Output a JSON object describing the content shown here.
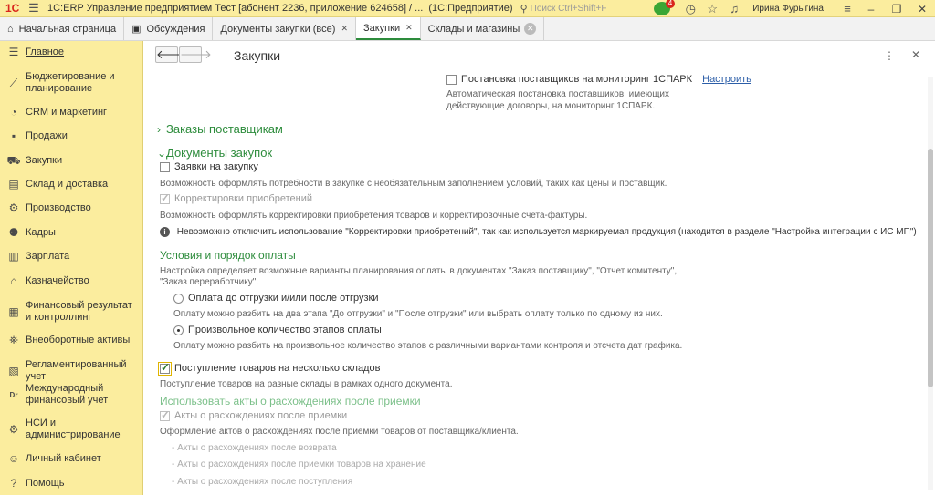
{
  "topbar": {
    "logo": "1С",
    "app_title": "1С:ERP Управление предприятием Тест [абонент 2236, приложение 624658] / ...",
    "platform": "(1С:Предприятие)",
    "search_placeholder": "Поиск Ctrl+Shift+F",
    "notifications_count": "4",
    "user_name": "Ирина Фурыгина"
  },
  "tabs": [
    {
      "label": "Начальная страница"
    },
    {
      "label": "Обсуждения"
    },
    {
      "label": "Документы закупки (все)"
    },
    {
      "label": "Закупки"
    },
    {
      "label": "Склады и магазины"
    }
  ],
  "sidebar": {
    "items": [
      {
        "label": "Главное",
        "icon": "menu-icon"
      },
      {
        "label": "Бюджетирование и планирование",
        "icon": "chart-icon"
      },
      {
        "label": "CRM и маркетинг",
        "icon": "crm-icon"
      },
      {
        "label": "Продажи",
        "icon": "sales-icon"
      },
      {
        "label": "Закупки",
        "icon": "cart-icon"
      },
      {
        "label": "Склад и доставка",
        "icon": "truck-icon"
      },
      {
        "label": "Производство",
        "icon": "production-icon"
      },
      {
        "label": "Кадры",
        "icon": "people-icon"
      },
      {
        "label": "Зарплата",
        "icon": "salary-icon"
      },
      {
        "label": "Казначейство",
        "icon": "treasury-icon"
      },
      {
        "label": "Финансовый результат и контроллинг",
        "icon": "finance-icon"
      },
      {
        "label": "Внеоборотные активы",
        "icon": "assets-icon"
      },
      {
        "label": "Регламентированный учет",
        "icon": "accounting-icon"
      },
      {
        "label": "Международный финансовый учет",
        "icon": "dr-cr-icon"
      },
      {
        "label": "НСИ и администрирование",
        "icon": "gear-icon"
      },
      {
        "label": "Личный кабинет",
        "icon": "user-icon"
      },
      {
        "label": "Помощь",
        "icon": "help-icon"
      }
    ]
  },
  "page": {
    "title": "Закупки",
    "spark_label": "Постановка поставщиков на мониторинг 1СПАРК",
    "spark_link": "Настроить",
    "spark_hint_1": "Автоматическая постановка поставщиков, имеющих",
    "spark_hint_2": "действующие договоры, на мониторинг 1СПАРК.",
    "section_orders": "Заказы поставщикам",
    "section_docs": "Документы закупок",
    "requests_label": "Заявки на закупку",
    "requests_hint": "Возможность оформлять потребности в закупке с необязательным заполнением условий, таких как цены и поставщик.",
    "corrections_label": "Корректировки приобретений",
    "corrections_hint": "Возможность оформлять корректировки приобретения товаров и корректировочные счета-фактуры.",
    "info_text": "Невозможно отключить использование \"Корректировки приобретений\", так как используется маркируемая продукция (находится в разделе \"Настройка интеграции с ИС МП\")",
    "payment_title": "Условия и порядок оплаты",
    "payment_hint_1": "Настройка определяет возможные варианты планирования оплаты в документах \"Заказ поставщику\", \"Отчет комитенту\",",
    "payment_hint_2": "\"Заказ переработчику\".",
    "radio1_label": "Оплата до отгрузки и/или после отгрузки",
    "radio1_hint": "Оплату можно разбить на два этапа \"До отгрузки\" и \"После отгрузки\" или выбрать оплату только по одному из них.",
    "radio2_label": "Произвольное количество этапов оплаты",
    "radio2_hint": "Оплату можно разбить на произвольное количество этапов с различными вариантами контроля и отсчета дат графика.",
    "multi_wh_label": "Поступление товаров на несколько складов",
    "multi_wh_hint": "Поступление товаров на разные склады в рамках одного документа.",
    "acts_title": "Использовать акты о расхождениях после приемки",
    "acts_label": "Акты о расхождениях после приемки",
    "acts_hint": "Оформление актов о расхождениях после приемки товаров от поставщика/клиента.",
    "acts_sub_1": "- Акты о расхождениях после возврата",
    "acts_sub_2": "- Акты о расхождениях после приемки товаров на хранение",
    "acts_sub_3": "- Акты о расхождениях после поступления"
  }
}
